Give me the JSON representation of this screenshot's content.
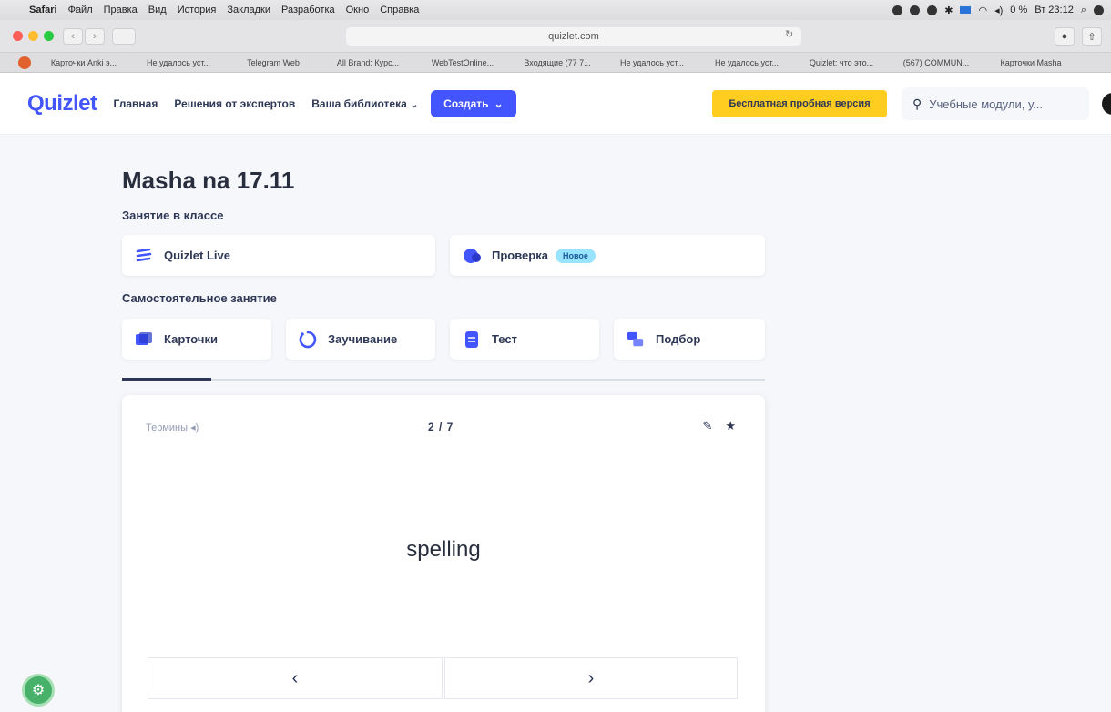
{
  "os_menubar": {
    "app": "Safari",
    "items": [
      "Файл",
      "Правка",
      "Вид",
      "История",
      "Закладки",
      "Разработка",
      "Окно",
      "Справка"
    ],
    "clock": "Вт 23:12",
    "battery": "0 %"
  },
  "browser": {
    "url": "quizlet.com",
    "bookmarks": [
      "Карточки Anki э...",
      "Не удалось уст...",
      "Telegram Web",
      "All Brand: Курс...",
      "WebTestOnline...",
      "Входящие (77 7...",
      "Не удалось уст...",
      "Не удалось уст...",
      "Quizlet: что это...",
      "(567) COMMUN...",
      "Карточки Masha"
    ]
  },
  "header": {
    "logo": "Quizlet",
    "nav": {
      "home": "Главная",
      "experts": "Решения от экспертов",
      "library": "Ваша библиотека"
    },
    "create": "Создать",
    "trial": "Бесплатная пробная версия",
    "search_placeholder": "Учебные модули, у..."
  },
  "set": {
    "title": "Masha na 17.11",
    "class_section": "Занятие в классе",
    "class_modes": [
      {
        "label": "Quizlet Live",
        "icon": "quizlet-live-icon"
      },
      {
        "label": "Проверка",
        "icon": "checkpoint-icon",
        "badge": "Новое"
      }
    ],
    "self_section": "Самостоятельное занятие",
    "self_modes": [
      {
        "label": "Карточки",
        "icon": "flashcards-icon"
      },
      {
        "label": "Заучивание",
        "icon": "learn-icon"
      },
      {
        "label": "Тест",
        "icon": "test-icon"
      },
      {
        "label": "Подбор",
        "icon": "match-icon"
      }
    ]
  },
  "flashcard": {
    "side_label": "Термины",
    "position": "2 / 7",
    "word": "spelling"
  },
  "colors": {
    "brand": "#4255ff",
    "trial": "#ffcd1f",
    "badge": "#98e3ff"
  }
}
